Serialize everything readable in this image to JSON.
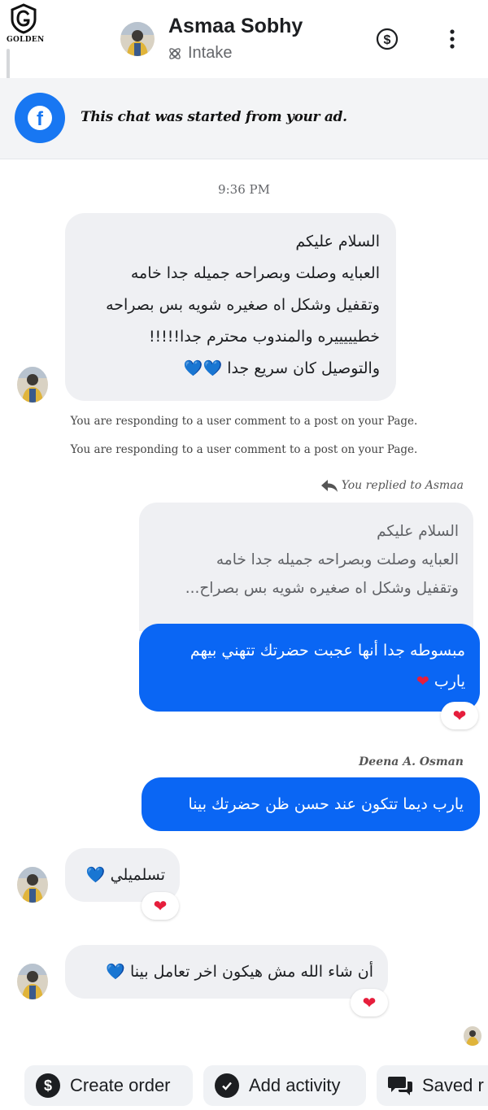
{
  "header": {
    "logo_text": "GOLDEN",
    "contact_name": "Asmaa Sobhy",
    "stage_label": "Intake"
  },
  "ad_banner": {
    "text": "This chat was started from your ad."
  },
  "timestamp": "9:36 PM",
  "messages": {
    "m1": {
      "lines": [
        "السلام عليكم",
        "العبايه وصلت وبصراحه جميله جدا خامه",
        "وتقفيل وشكل اه صغيره شويه بس بصراحه",
        "خطيييييره والمندوب محترم جدا!!!!!",
        "والتوصيل كان سريع جدا"
      ],
      "emoji": "💙💙"
    },
    "system_notes": [
      "You are responding to a user comment to a post on your Page.",
      "You are responding to a user comment to a post on your Page."
    ],
    "reply_label": "You replied to Asmaa",
    "quote_lines": [
      "السلام عليكم",
      "العبايه وصلت وبصراحه جميله جدا خامه",
      "وتقفيل وشكل اه صغيره شويه بس بصراح..."
    ],
    "m2": {
      "lines": [
        "مبسوطه جدا أنها عجبت حضرتك تتهني بيهم",
        "يارب"
      ],
      "emoji": "❤",
      "reaction": "❤"
    },
    "sender_label": "Deena A. Osman",
    "m3": {
      "text": "يارب ديما تتكون عند حسن ظن حضرتك بينا"
    },
    "m4": {
      "text": "تسلميلي",
      "emoji": "💙",
      "reaction": "❤"
    },
    "m5": {
      "text": "أن شاء الله مش هيكون اخر تعامل بينا",
      "emoji": "💙",
      "reaction": "❤"
    }
  },
  "actions": {
    "create_order": "Create order",
    "add_activity": "Add activity",
    "saved_replies": "Saved r"
  },
  "colors": {
    "accent": "#0a66f4",
    "facebook_blue": "#1877f2",
    "incoming_bubble": "#eff0f3",
    "blue_heart": "#5aaef2",
    "red_heart": "#e61e3c"
  }
}
